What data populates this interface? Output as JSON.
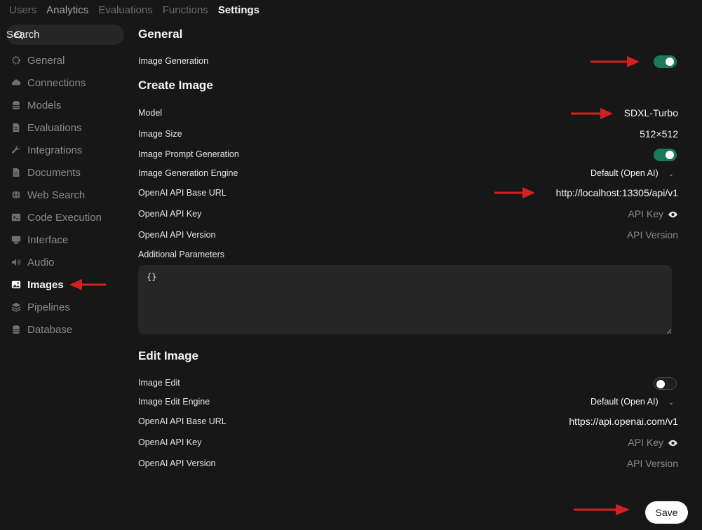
{
  "nav": {
    "tabs": [
      {
        "label": "Users",
        "state": "dim"
      },
      {
        "label": "Analytics",
        "state": "mid"
      },
      {
        "label": "Evaluations",
        "state": "dim"
      },
      {
        "label": "Functions",
        "state": "dim"
      },
      {
        "label": "Settings",
        "state": "active"
      }
    ]
  },
  "search": {
    "label": "Search"
  },
  "sidebar": {
    "items": [
      {
        "label": "General",
        "icon": "gear-icon"
      },
      {
        "label": "Connections",
        "icon": "cloud-icon"
      },
      {
        "label": "Models",
        "icon": "database-icon"
      },
      {
        "label": "Evaluations",
        "icon": "document-icon"
      },
      {
        "label": "Integrations",
        "icon": "wrench-icon"
      },
      {
        "label": "Documents",
        "icon": "document-icon"
      },
      {
        "label": "Web Search",
        "icon": "globe-icon"
      },
      {
        "label": "Code Execution",
        "icon": "terminal-icon"
      },
      {
        "label": "Interface",
        "icon": "monitor-icon"
      },
      {
        "label": "Audio",
        "icon": "speaker-icon"
      },
      {
        "label": "Images",
        "icon": "image-icon",
        "active": true
      },
      {
        "label": "Pipelines",
        "icon": "layers-icon"
      },
      {
        "label": "Database",
        "icon": "database-icon"
      }
    ]
  },
  "general": {
    "heading": "General",
    "image_generation_label": "Image Generation",
    "image_generation_on": true
  },
  "create": {
    "heading": "Create Image",
    "model_label": "Model",
    "model_value": "SDXL-Turbo",
    "size_label": "Image Size",
    "size_value": "512×512",
    "prompt_gen_label": "Image Prompt Generation",
    "prompt_gen_on": true,
    "engine_label": "Image Generation Engine",
    "engine_value": "Default (Open AI)",
    "base_url_label": "OpenAI API Base URL",
    "base_url_value": "http://localhost:13305/api/v1",
    "api_key_label": "OpenAI API Key",
    "api_key_placeholder": "API Key",
    "api_version_label": "OpenAI API Version",
    "api_version_placeholder": "API Version",
    "params_label": "Additional Parameters",
    "params_value": "{}"
  },
  "edit": {
    "heading": "Edit Image",
    "image_edit_label": "Image Edit",
    "image_edit_on": false,
    "engine_label": "Image Edit Engine",
    "engine_value": "Default (Open AI)",
    "base_url_label": "OpenAI API Base URL",
    "base_url_value": "https://api.openai.com/v1",
    "api_key_label": "OpenAI API Key",
    "api_key_placeholder": "API Key",
    "api_version_label": "OpenAI API Version",
    "api_version_placeholder": "API Version"
  },
  "footer": {
    "save_label": "Save"
  },
  "colors": {
    "accent": "#1a7a55",
    "annotation_arrow": "#d42020",
    "background": "#171717"
  }
}
